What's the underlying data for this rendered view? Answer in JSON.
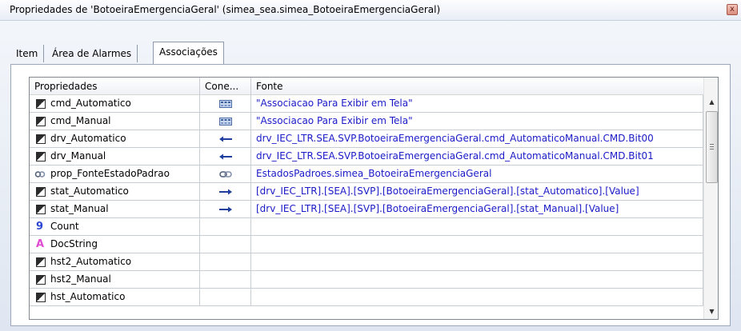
{
  "window": {
    "title": "Propriedades de 'BotoeiraEmergenciaGeral' (simea_sea.simea_BotoeiraEmergenciaGeral)",
    "close_glyph": "x"
  },
  "tabs": [
    {
      "label": "Item",
      "active": false
    },
    {
      "label": "Área de Alarmes",
      "active": false
    },
    {
      "label": "Associações",
      "active": true
    }
  ],
  "grid": {
    "columns": [
      "Propriedades",
      "Cone...",
      "Fonte"
    ],
    "rows": [
      {
        "name": "cmd_Automatico",
        "icon": "property-icon",
        "connection": "display-association-icon",
        "source": "\"Associacao Para Exibir em Tela\""
      },
      {
        "name": "cmd_Manual",
        "icon": "property-icon",
        "connection": "display-association-icon",
        "source": "\"Associacao Para Exibir em Tela\""
      },
      {
        "name": "drv_Automatico",
        "icon": "property-icon",
        "connection": "arrow-left-icon",
        "source": "drv_IEC_LTR.SEA.SVP.BotoeiraEmergenciaGeral.cmd_AutomaticoManual.CMD.Bit00"
      },
      {
        "name": "drv_Manual",
        "icon": "property-icon",
        "connection": "arrow-left-icon",
        "source": "drv_IEC_LTR.SEA.SVP.BotoeiraEmergenciaGeral.cmd_AutomaticoManual.CMD.Bit01"
      },
      {
        "name": "prop_FonteEstadoPadrao",
        "icon": "link-icon",
        "connection": "link-icon",
        "source": "EstadosPadroes.simea_BotoeiraEmergenciaGeral"
      },
      {
        "name": "stat_Automatico",
        "icon": "property-icon",
        "connection": "arrow-right-icon",
        "source": "[drv_IEC_LTR].[SEA].[SVP].[BotoeiraEmergenciaGeral].[stat_Automatico].[Value]"
      },
      {
        "name": "stat_Manual",
        "icon": "property-icon",
        "connection": "arrow-right-icon",
        "source": "[drv_IEC_LTR].[SEA].[SVP].[BotoeiraEmergenciaGeral].[stat_Manual].[Value]"
      },
      {
        "name": "Count",
        "icon": "count-icon",
        "connection": "",
        "source": ""
      },
      {
        "name": "DocString",
        "icon": "docstring-icon",
        "connection": "",
        "source": ""
      },
      {
        "name": "hst2_Automatico",
        "icon": "property-icon",
        "connection": "",
        "source": ""
      },
      {
        "name": "hst2_Manual",
        "icon": "property-icon",
        "connection": "",
        "source": ""
      },
      {
        "name": "hst_Automatico",
        "icon": "property-icon",
        "connection": "",
        "source": ""
      }
    ]
  },
  "icons": {
    "count_glyph": "9",
    "docstring_glyph": "A",
    "scroll_up_glyph": "▲",
    "scroll_down_glyph": "▼"
  },
  "colors": {
    "source_text": "#1a1ac8",
    "arrow": "#1e3f9e",
    "count_icon": "#2b45d6",
    "docstring_icon": "#e14ad1"
  }
}
